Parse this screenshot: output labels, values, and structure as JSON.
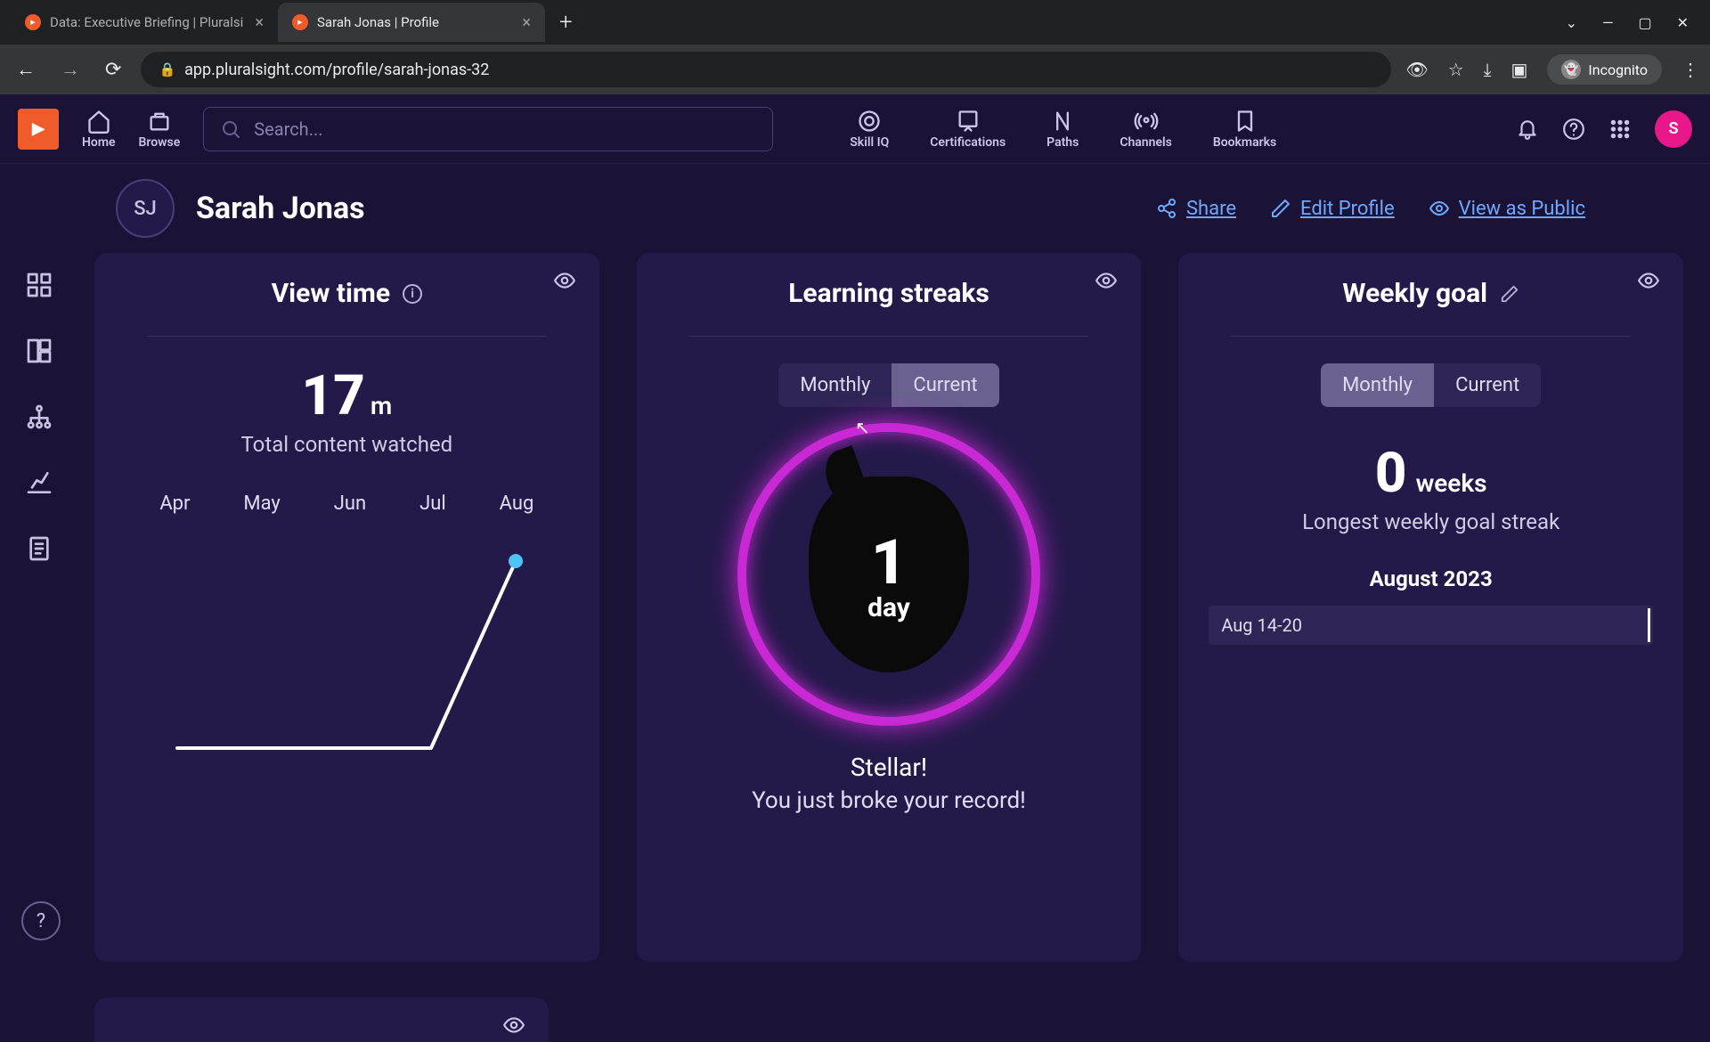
{
  "browser": {
    "tabs": [
      {
        "title": "Data: Executive Briefing | Pluralsi",
        "active": false
      },
      {
        "title": "Sarah Jonas | Profile",
        "active": true
      }
    ],
    "url": "app.pluralsight.com/profile/sarah-jonas-32",
    "incognito_label": "Incognito"
  },
  "topnav": {
    "home": "Home",
    "browse": "Browse",
    "search_placeholder": "Search...",
    "skill_iq": "Skill IQ",
    "certifications": "Certifications",
    "paths": "Paths",
    "channels": "Channels",
    "bookmarks": "Bookmarks",
    "user_initial": "S"
  },
  "profile": {
    "initials": "SJ",
    "name": "Sarah Jonas",
    "actions": {
      "share": "Share",
      "edit": "Edit Profile",
      "view_public": "View as Public"
    }
  },
  "view_time": {
    "title": "View time",
    "value": "17",
    "unit": "m",
    "sublabel": "Total content watched",
    "months": [
      "Apr",
      "May",
      "Jun",
      "Jul",
      "Aug"
    ]
  },
  "streaks": {
    "title": "Learning streaks",
    "toggle": {
      "monthly": "Monthly",
      "current": "Current"
    },
    "count": "1",
    "unit": "day",
    "headline": "Stellar!",
    "subline": "You just broke your record!"
  },
  "weekly_goal": {
    "title": "Weekly goal",
    "toggle": {
      "monthly": "Monthly",
      "current": "Current"
    },
    "count": "0",
    "unit": "weeks",
    "sublabel": "Longest weekly goal streak",
    "month": "August 2023",
    "range": "Aug 14-20"
  },
  "chart_data": {
    "type": "line",
    "title": "View time",
    "xlabel": "",
    "ylabel": "minutes",
    "categories": [
      "Apr",
      "May",
      "Jun",
      "Jul",
      "Aug"
    ],
    "values": [
      0,
      0,
      0,
      0,
      17
    ],
    "ylim": [
      0,
      20
    ]
  }
}
